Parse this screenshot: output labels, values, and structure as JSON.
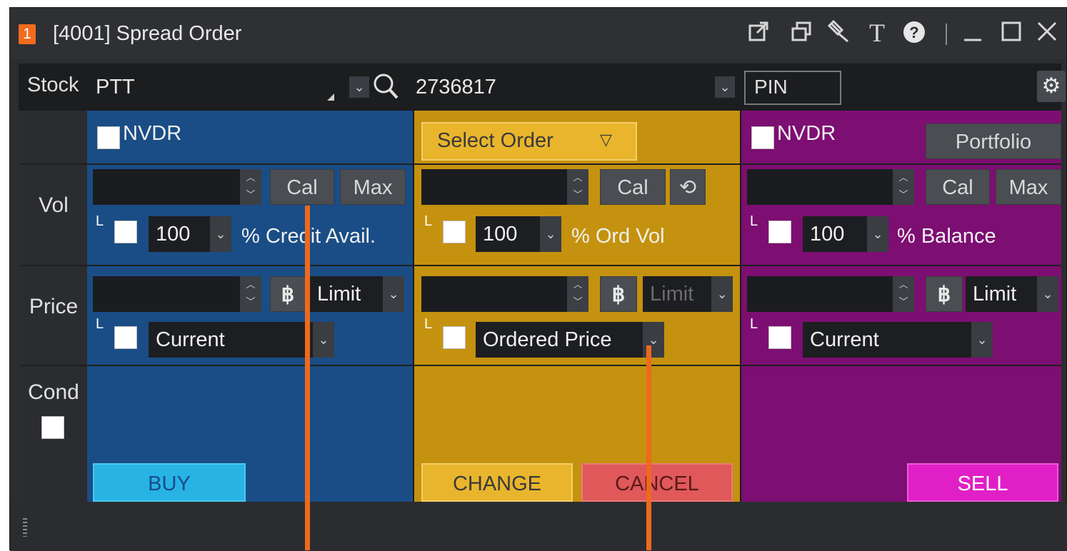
{
  "window": {
    "number": "1",
    "title": "[4001] Spread Order"
  },
  "titlebar_icons": [
    "popout-icon",
    "restore-copy-icon",
    "pin-icon",
    "font-icon",
    "help-icon",
    "minimize-icon",
    "maximize-icon",
    "close-icon"
  ],
  "stock": {
    "label": "Stock",
    "symbol": "PTT",
    "account": "2736817",
    "pin_placeholder": "PIN"
  },
  "rows": {
    "vol": "Vol",
    "price": "Price",
    "cond": "Cond"
  },
  "buy": {
    "nvdr": "NVDR",
    "cal": "Cal",
    "max": "Max",
    "pct": "100",
    "pct_label": "% Credit Avail.",
    "currency": "฿",
    "order_type": "Limit",
    "price_mode": "Current",
    "action": "BUY"
  },
  "order": {
    "select_order": "Select Order",
    "cal": "Cal",
    "pct": "100",
    "pct_label": "% Ord Vol",
    "currency": "฿",
    "order_type": "Limit",
    "price_mode": "Ordered Price",
    "change": "CHANGE",
    "cancel": "CANCEL"
  },
  "sell": {
    "nvdr": "NVDR",
    "portfolio": "Portfolio",
    "cal": "Cal",
    "max": "Max",
    "pct": "100",
    "pct_label": "% Balance",
    "currency": "฿",
    "order_type": "Limit",
    "price_mode": "Current",
    "action": "SELL"
  },
  "colors": {
    "buy_panel": "#1a4d86",
    "order_panel": "#c5920f",
    "sell_panel": "#7d0e72",
    "buy_button": "#27b4e4",
    "sell_button": "#e020c6",
    "cancel_button": "#e0585a",
    "change_button": "#e9b52c",
    "marker": "#ec6a1e"
  }
}
